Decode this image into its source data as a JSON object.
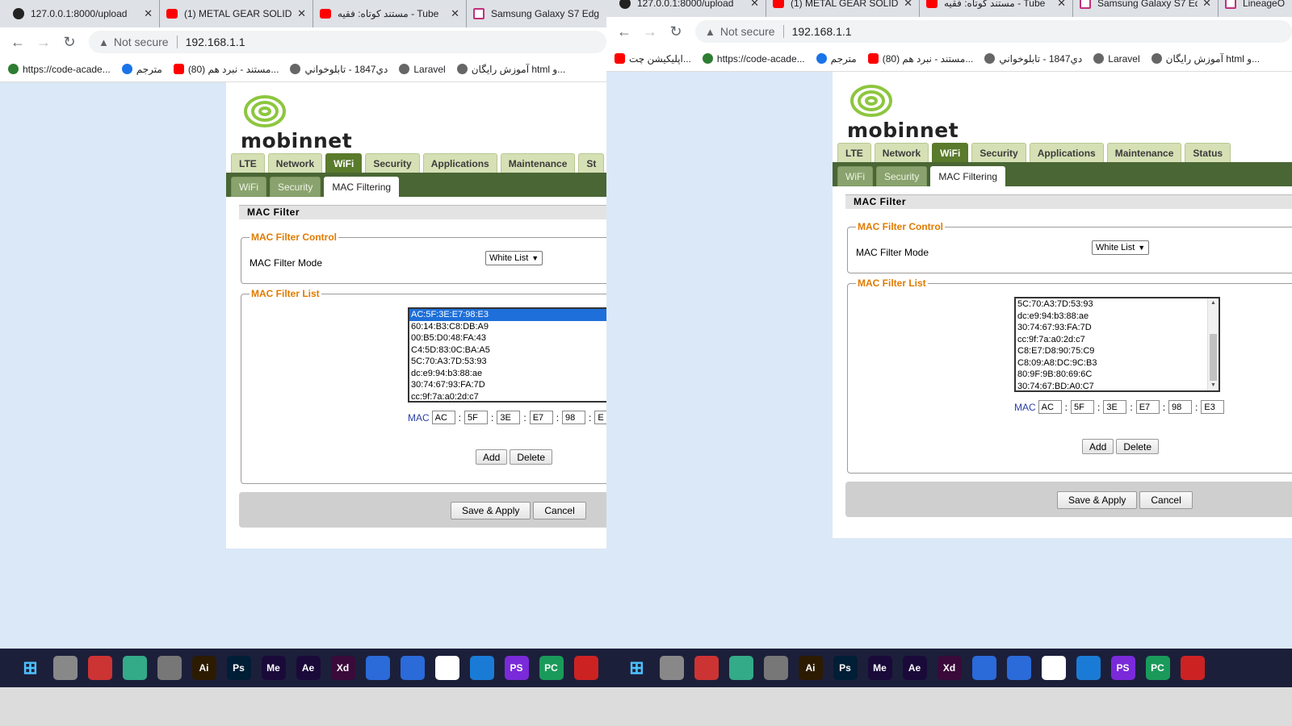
{
  "left_window": {
    "tabs": [
      {
        "title": "127.0.0.1:8000/upload",
        "favicon": "github-icon"
      },
      {
        "title": "(1) METAL GEAR SOLID",
        "favicon": "youtube-icon"
      },
      {
        "title": "مستند کوتاه: فقیه - Tube",
        "favicon": "youtube-icon"
      },
      {
        "title": "Samsung Galaxy S7 Edg",
        "favicon": "site-icon"
      }
    ],
    "security_label": "Not secure",
    "url": "192.168.1.1",
    "bookmarks": [
      "آموزش رایگان html و...",
      "Laravel",
      "دي1847 - تابلوخواني",
      "(80) مستند - نبرد هم...",
      "مترجم",
      "https://code-acade..."
    ],
    "router": {
      "brand": "mobinnet",
      "main_tabs": [
        "LTE",
        "Network",
        "WiFi",
        "Security",
        "Applications",
        "Maintenance",
        "St"
      ],
      "active_main_tab": "WiFi",
      "sub_tabs": [
        "WiFi",
        "Security",
        "MAC Filtering"
      ],
      "active_sub_tab": "MAC Filtering",
      "section_title": "MAC Filter",
      "control_legend": "MAC Filter Control",
      "mode_label": "MAC Filter Mode",
      "mode_value": "White List",
      "list_legend": "MAC Filter List",
      "mac_list": [
        "AC:5F:3E:E7:98:E3",
        "60:14:B3:C8:DB:A9",
        "00:B5:D0:48:FA:43",
        "C4:5D:83:0C:BA:A5",
        "5C:70:A3:7D:53:93",
        "dc:e9:94:b3:88:ae",
        "30:74:67:93:FA:7D",
        "cc:9f:7a:a0:2d:c7"
      ],
      "selected_index": 0,
      "mac_label": "MAC",
      "mac_octets": [
        "AC",
        "5F",
        "3E",
        "E7",
        "98",
        "E"
      ],
      "add_label": "Add",
      "delete_label": "Delete",
      "save_label": "Save & Apply",
      "cancel_label": "Cancel"
    }
  },
  "right_window": {
    "tabs": [
      {
        "title": "127.0.0.1:8000/upload",
        "favicon": "github-icon"
      },
      {
        "title": "(1) METAL GEAR SOLID",
        "favicon": "youtube-icon"
      },
      {
        "title": "مستند کوتاه: فقیه - Tube",
        "favicon": "youtube-icon"
      },
      {
        "title": "Samsung Galaxy S7 Edg",
        "favicon": "site-icon"
      },
      {
        "title": "LineageO",
        "favicon": "site-icon"
      }
    ],
    "security_label": "Not secure",
    "url": "192.168.1.1",
    "bookmarks": [
      "آموزش رایگان html و...",
      "Laravel",
      "دي1847 - تابلوخواني",
      "(80) مستند - نبرد هم...",
      "مترجم",
      "https://code-acade...",
      "اپلیکیشن چت..."
    ],
    "router": {
      "brand": "mobinnet",
      "main_tabs": [
        "LTE",
        "Network",
        "WiFi",
        "Security",
        "Applications",
        "Maintenance",
        "Status"
      ],
      "active_main_tab": "WiFi",
      "sub_tabs": [
        "WiFi",
        "Security",
        "MAC Filtering"
      ],
      "active_sub_tab": "MAC Filtering",
      "section_title": "MAC Filter",
      "control_legend": "MAC Filter Control",
      "mode_label": "MAC Filter Mode",
      "mode_value": "White List",
      "list_legend": "MAC Filter List",
      "mac_list": [
        "5C:70:A3:7D:53:93",
        "dc:e9:94:b3:88:ae",
        "30:74:67:93:FA:7D",
        "cc:9f:7a:a0:2d:c7",
        "C8:E7:D8:90:75:C9",
        "C8:09:A8:DC:9C:B3",
        "80:9F:9B:80:69:6C",
        "30:74:67:BD:A0:C7"
      ],
      "selected_index": -1,
      "mac_label": "MAC",
      "mac_octets": [
        "AC",
        "5F",
        "3E",
        "E7",
        "98",
        "E3"
      ],
      "add_label": "Add",
      "delete_label": "Delete",
      "save_label": "Save & Apply",
      "cancel_label": "Cancel"
    }
  },
  "taskbar": {
    "apps": [
      "windows-start-icon",
      "task-view-icon",
      "app-icon",
      "app-icon",
      "calculator-icon",
      "illustrator-icon",
      "photoshop-icon",
      "media-encoder-icon",
      "after-effects-icon",
      "xd-icon",
      "mail-icon",
      "chrome-icon",
      "app-icon",
      "vscode-icon",
      "phpstorm-icon",
      "pycharm-icon",
      "app-icon"
    ],
    "app_labels": [
      "⊞",
      "",
      "",
      "",
      "",
      "Ai",
      "Ps",
      "Me",
      "Ae",
      "Xd",
      "",
      "",
      "",
      "",
      "PS",
      "PC",
      ""
    ],
    "app_colors": [
      "#1c1f3a",
      "#888888",
      "#c33",
      "#3a8",
      "#777",
      "#2c1b00",
      "#001e36",
      "#1a0a3a",
      "#1a0a3a",
      "#3a0a3a",
      "#2a6ad9",
      "#2a6ad9",
      "#fff",
      "#1a7bd6",
      "#7a2ad9",
      "#1a9a5a",
      "#c22"
    ]
  }
}
